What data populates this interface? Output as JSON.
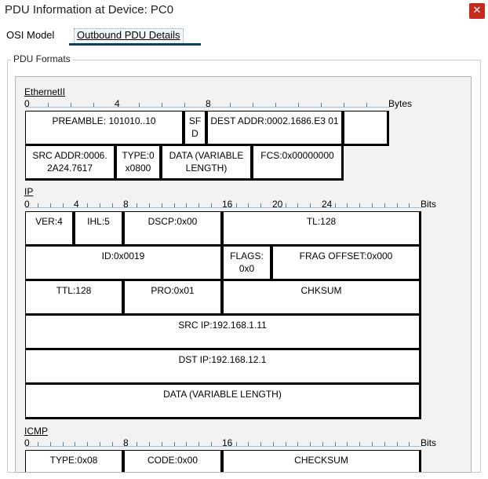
{
  "window": {
    "title": "PDU Information at Device: PC0",
    "close_glyph": "✕"
  },
  "tabs": [
    {
      "label": "OSI Model"
    },
    {
      "label": "Outbound PDU Details"
    }
  ],
  "group": {
    "label": "PDU Formats"
  },
  "ethernet": {
    "title": "EthernetII",
    "unit": "Bytes",
    "ruler": [
      "0",
      "4",
      "8"
    ],
    "cells": {
      "preamble": "PREAMBLE: 101010..10",
      "sfd": "SF D",
      "dest": "DEST ADDR:0002.1686.E3 01",
      "src": "SRC ADDR:0006. 2A24.7617",
      "type": "TYPE:0 x0800",
      "data": "DATA (VARIABLE LENGTH)",
      "fcs": "FCS:0x00000000"
    }
  },
  "ip": {
    "title": "IP",
    "unit": "Bits",
    "ruler": [
      "0",
      "4",
      "8",
      "16",
      "20",
      "24"
    ],
    "cells": {
      "ver": "VER:4",
      "ihl": "IHL:5",
      "dscp": "DSCP:0x00",
      "tl": "TL:128",
      "id": "ID:0x0019",
      "flags": "FLAGS: 0x0",
      "frag": "FRAG OFFSET:0x000",
      "ttl": "TTL:128",
      "pro": "PRO:0x01",
      "chksum": "CHKSUM",
      "src_ip": "SRC IP:192.168.1.11",
      "dst_ip": "DST IP:192.168.12.1",
      "data": "DATA (VARIABLE LENGTH)"
    }
  },
  "icmp": {
    "title": "ICMP",
    "unit": "Bits",
    "ruler": [
      "0",
      "8",
      "16"
    ],
    "cells": {
      "type": "TYPE:0x08",
      "code": "CODE:0x00",
      "checksum": "CHECKSUM"
    }
  }
}
